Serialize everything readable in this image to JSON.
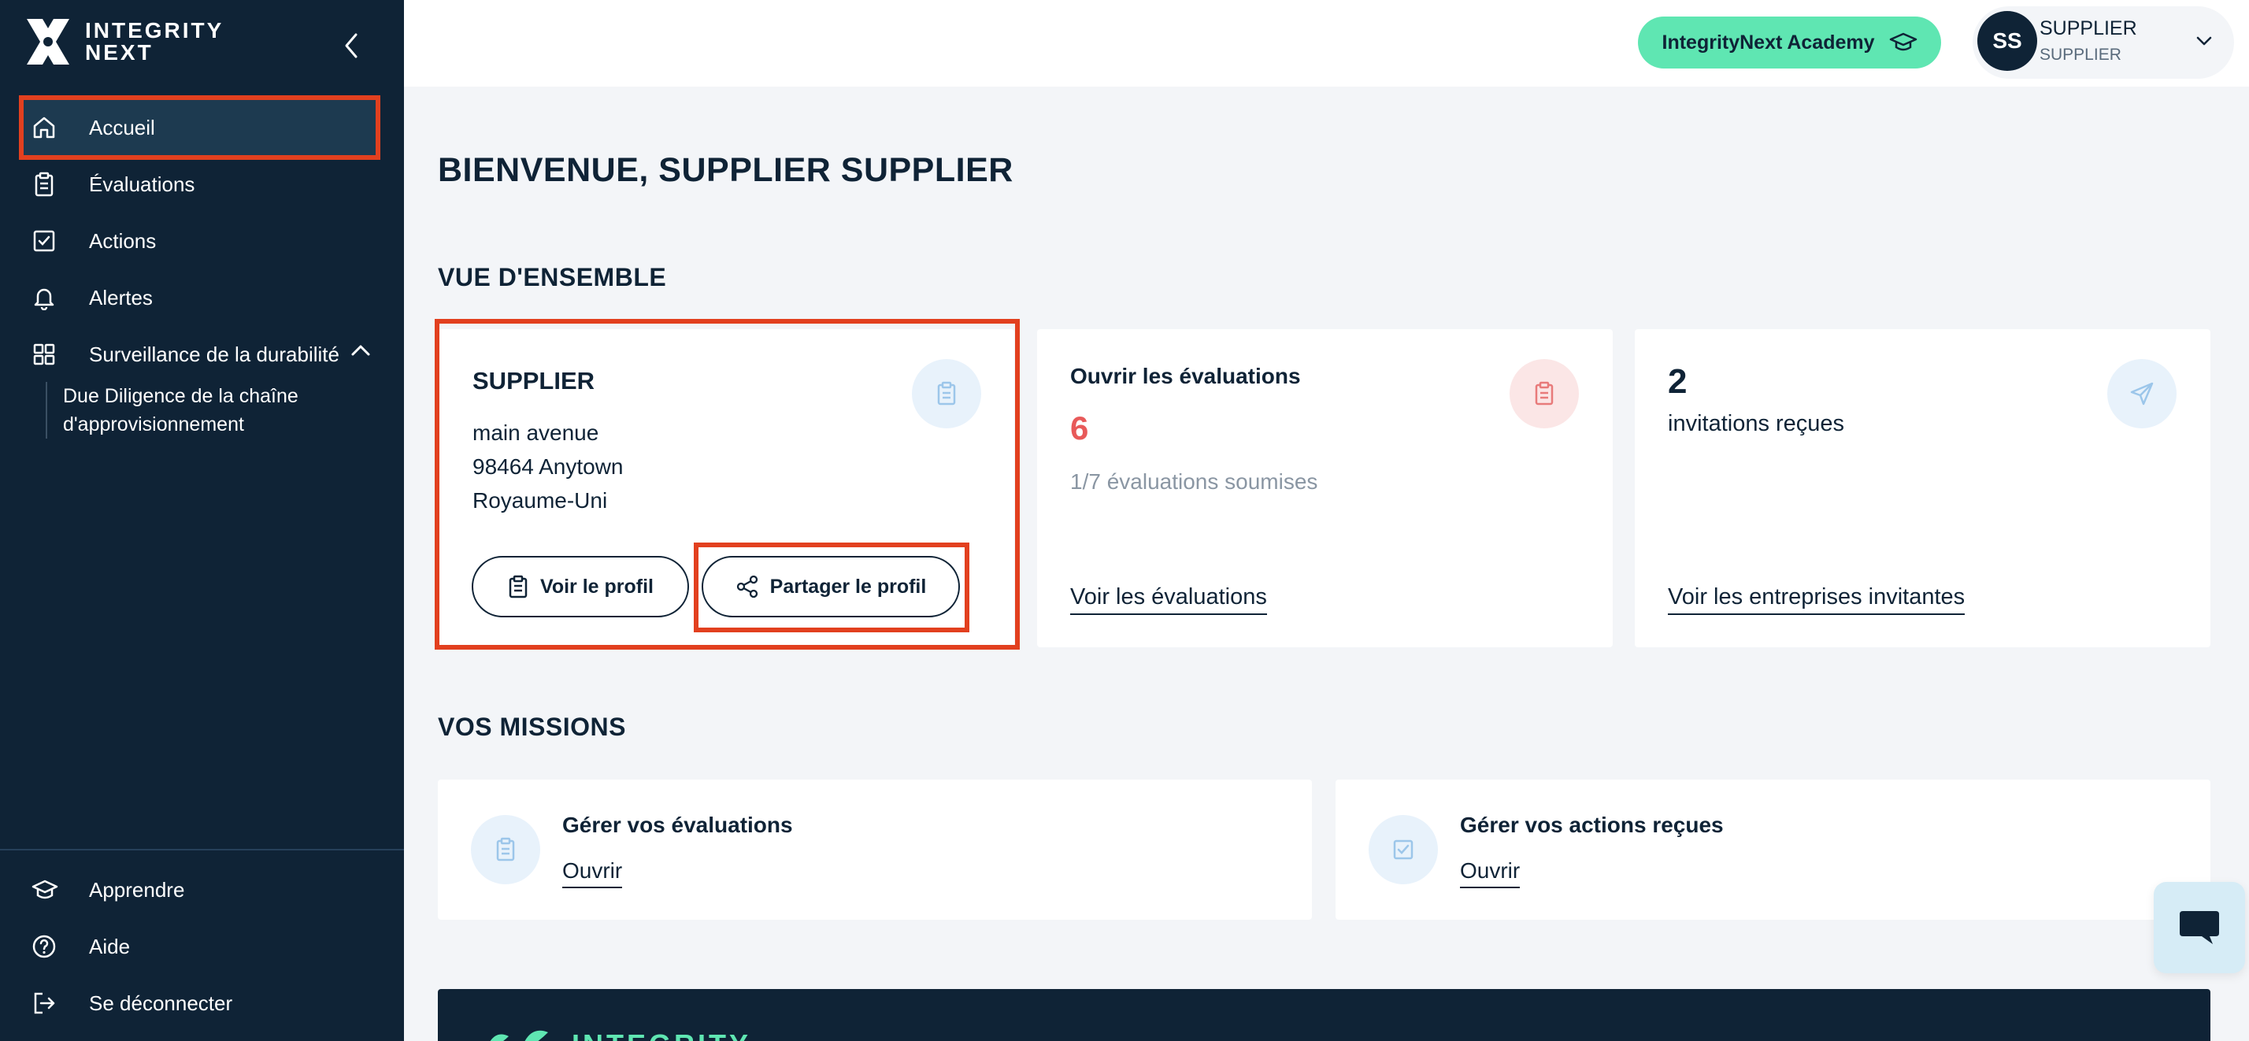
{
  "brand": {
    "line1": "INTEGRITY",
    "line2": "NEXT"
  },
  "sidebar": {
    "items": [
      {
        "label": "Accueil",
        "icon": "home-icon"
      },
      {
        "label": "Évaluations",
        "icon": "clipboard-icon"
      },
      {
        "label": "Actions",
        "icon": "checkbox-icon"
      },
      {
        "label": "Alertes",
        "icon": "bell-icon"
      },
      {
        "label": "Surveillance de la durabilité",
        "icon": "grid-icon"
      }
    ],
    "subitem": "Due Diligence de la chaîne d'approvisionnement",
    "bottom": [
      {
        "label": "Apprendre",
        "icon": "graduation-cap-icon"
      },
      {
        "label": "Aide",
        "icon": "help-circle-icon"
      },
      {
        "label": "Se déconnecter",
        "icon": "logout-icon"
      }
    ]
  },
  "topbar": {
    "academy_label": "IntegrityNext Academy",
    "avatar_initials": "SS",
    "user_name": "SUPPLIER",
    "user_role": "SUPPLIER"
  },
  "main": {
    "welcome": "BIENVENUE, SUPPLIER SUPPLIER",
    "overview_title": "VUE D'ENSEMBLE",
    "profile_card": {
      "name": "SUPPLIER",
      "address_lines": [
        "main avenue",
        "98464 Anytown",
        "Royaume-Uni"
      ],
      "view_profile": "Voir le profil",
      "share_profile": "Partager le profil"
    },
    "evaluations_card": {
      "title": "Ouvrir les évaluations",
      "count": "6",
      "submitted": "1/7 évaluations soumises",
      "link": "Voir les évaluations"
    },
    "invitations_card": {
      "count": "2",
      "label": "invitations reçues",
      "link": "Voir les entreprises invitantes"
    },
    "missions_title": "VOS MISSIONS",
    "missions": [
      {
        "title": "Gérer vos évaluations",
        "link": "Ouvrir"
      },
      {
        "title": "Gérer vos actions reçues",
        "link": "Ouvrir"
      }
    ],
    "banner_text": "INTEGRITY"
  },
  "colors": {
    "navy": "#0f2336",
    "mint": "#5fe6b2",
    "alert_red": "#e85a5a",
    "highlight": "#e2401f"
  }
}
